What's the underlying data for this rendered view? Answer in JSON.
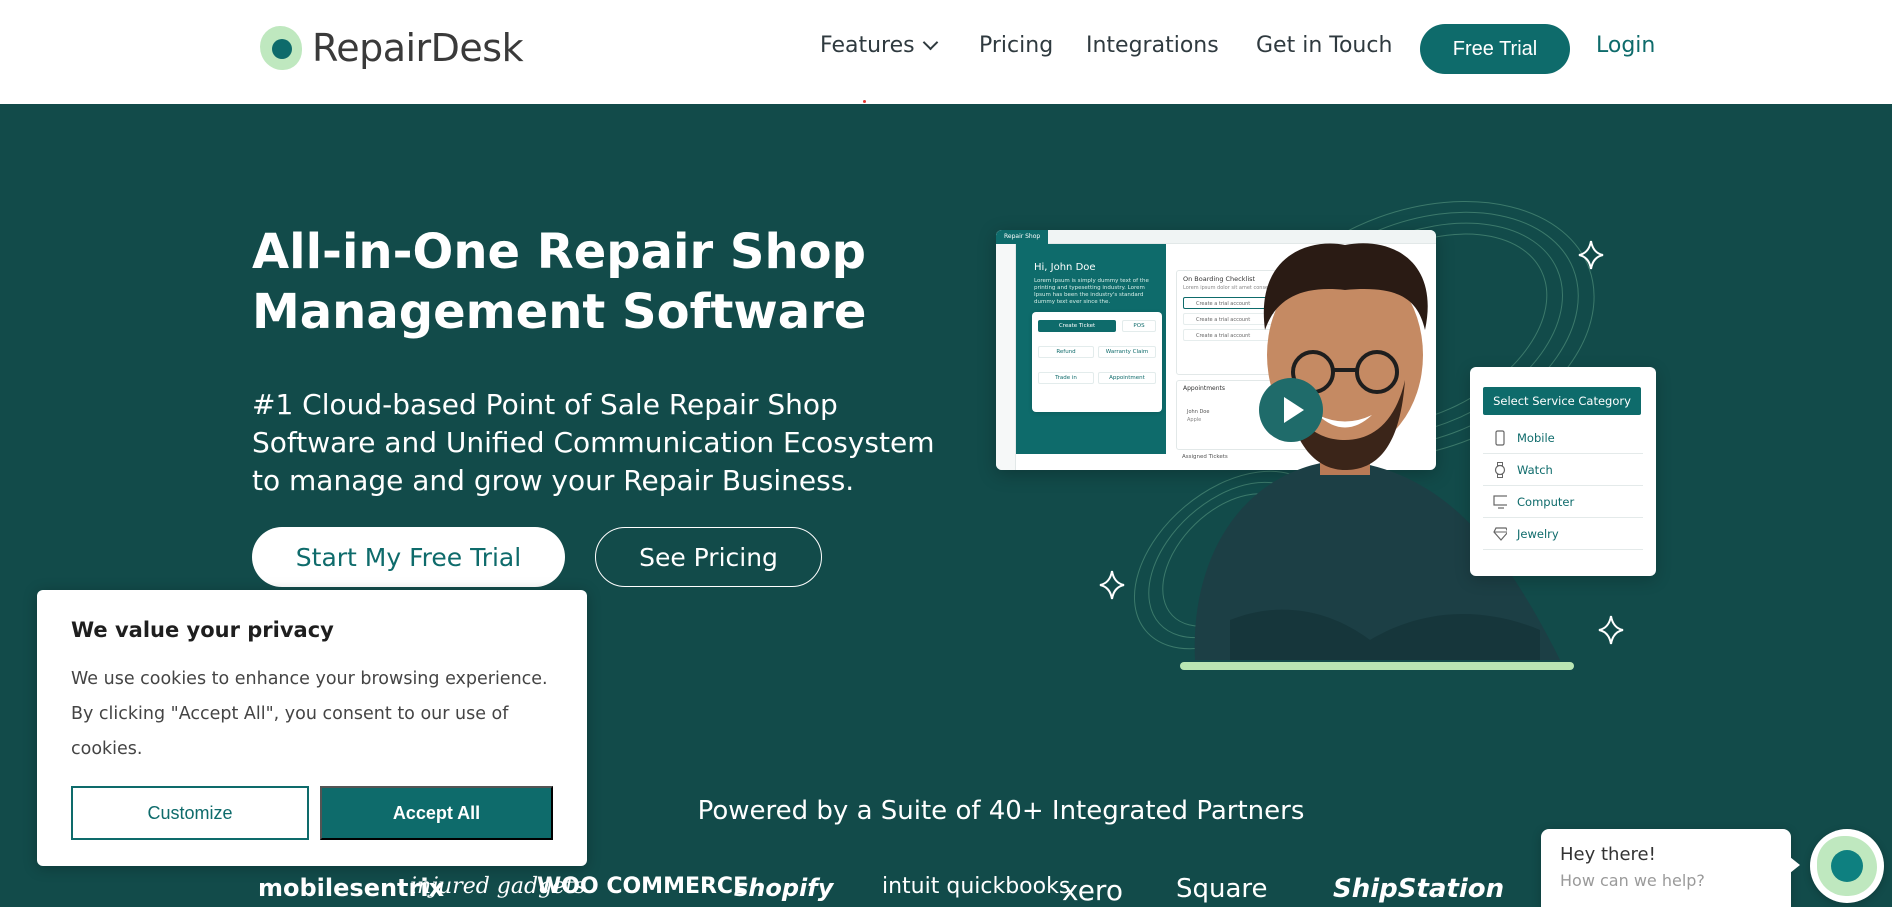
{
  "colors": {
    "brand": "#0e6b6b",
    "hero_bg": "#124b4a",
    "accent_green": "#bfe8bf",
    "white": "#ffffff"
  },
  "nav": {
    "logo_text": "RepairDesk",
    "features": "Features",
    "pricing": "Pricing",
    "integrations": "Integrations",
    "get_in_touch": "Get in Touch",
    "free_trial": "Free Trial",
    "login": "Login"
  },
  "hero": {
    "title_line1": "All-in-One Repair Shop",
    "title_line2": "Management Software",
    "subtitle": "#1 Cloud-based Point of Sale Repair Shop Software and Unified Communication Ecosystem to manage and grow your Repair Business.",
    "start_trial": "Start My Free Trial",
    "see_pricing": "See Pricing"
  },
  "mockup": {
    "brand": "Repair Shop",
    "greeting": "Hi, John Doe",
    "lorem": "Lorem Ipsum is simply dummy text of the printing and typesetting industry. Lorem Ipsum has been the industry's standard dummy text ever since the.",
    "actions": [
      "Create Ticket",
      "POS",
      "Refund",
      "Warranty Claim",
      "Trade in",
      "Appointment"
    ],
    "checklist_title": "On Boarding Checklist",
    "checklist_sub": "Lorem ipsum dolor sit amet consectetur.",
    "checklist_items": [
      "Create a trial account",
      "Create a trial account",
      "Create a trial account"
    ],
    "appointments_title": "Appointments",
    "appointment_name": "John Doe",
    "appointment_device": "Apple",
    "assigned_tickets": "Assigned Tickets"
  },
  "service_card": {
    "header": "Select Service Category",
    "items": [
      {
        "label": "Mobile",
        "icon": "mobile-icon"
      },
      {
        "label": "Watch",
        "icon": "watch-icon"
      },
      {
        "label": "Computer",
        "icon": "computer-icon"
      },
      {
        "label": "Jewelry",
        "icon": "jewelry-icon"
      }
    ]
  },
  "partners": {
    "title": "Powered by a Suite of 40+ Integrated Partners",
    "logos": [
      "mobilesentrix",
      "injured gadgets",
      "WOO COMMERCE",
      "shopify",
      "intuit quickbooks",
      "xero",
      "Square",
      "ShipStation"
    ]
  },
  "cookie": {
    "title": "We value your privacy",
    "text": "We use cookies to enhance your browsing experience. By clicking \"Accept All\", you consent to our use of cookies.",
    "customize": "Customize",
    "accept_all": "Accept All"
  },
  "chat": {
    "greeting": "Hey there!",
    "help": "How can we help?"
  }
}
